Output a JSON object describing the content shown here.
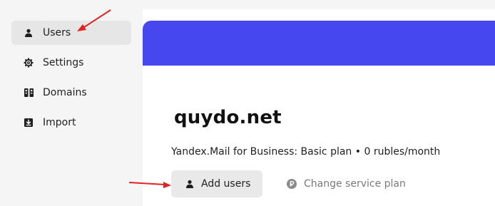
{
  "sidebar": {
    "items": [
      {
        "label": "Users",
        "icon": "user-icon",
        "active": true
      },
      {
        "label": "Settings",
        "icon": "gear-icon",
        "active": false
      },
      {
        "label": "Domains",
        "icon": "domains-icon",
        "active": false
      },
      {
        "label": "Import",
        "icon": "import-icon",
        "active": false
      }
    ]
  },
  "main": {
    "org_name": "quydo.net",
    "plan_description": "Yandex.Mail for Business: Basic plan • 0 rubles/month",
    "add_users_label": "Add users",
    "change_plan_label": "Change service plan"
  },
  "colors": {
    "banner": "#4747ef",
    "sidebar_bg": "#f5f5f5",
    "active_item_bg": "#e6e6e6",
    "button_bg": "#e9e9e9",
    "muted_text": "#7a7a7a",
    "annotation_arrow": "#e32222"
  },
  "annotations": [
    "arrow pointing to Users nav item",
    "arrow pointing to Add users button"
  ]
}
